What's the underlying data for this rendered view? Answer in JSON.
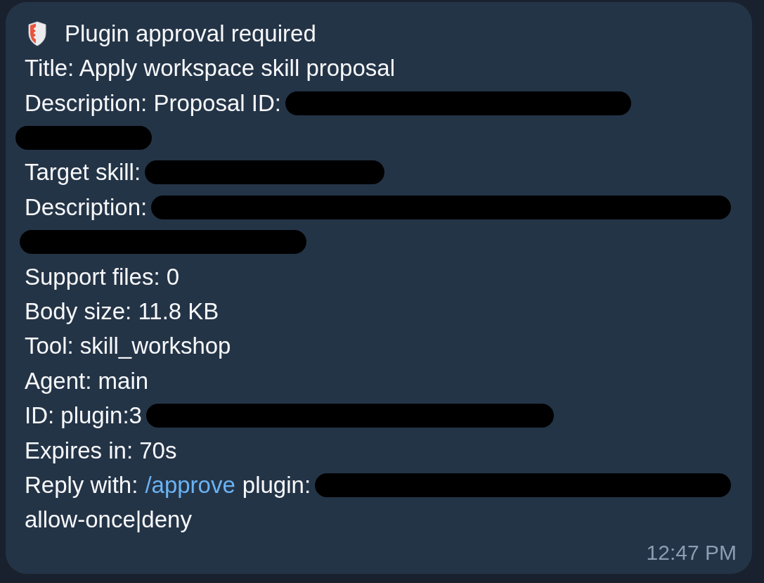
{
  "message": {
    "header": {
      "title": "Plugin approval required"
    },
    "lines": [
      {
        "kind": "text",
        "text": "Title: Apply workspace skill proposal",
        "redacted": false
      },
      {
        "kind": "text",
        "text": "Description: Proposal ID:",
        "redacted": true
      },
      {
        "kind": "redacted"
      },
      {
        "kind": "text",
        "text": "Target skill:",
        "redacted": true
      },
      {
        "kind": "text",
        "text": "Description:",
        "redacted": true
      },
      {
        "kind": "redacted"
      },
      {
        "kind": "text",
        "text": "Support files: 0",
        "redacted": false
      },
      {
        "kind": "text",
        "text": "Body size: 11.8 KB",
        "redacted": false
      },
      {
        "kind": "text",
        "text": "Tool: skill_workshop",
        "redacted": false
      },
      {
        "kind": "text",
        "text": "Agent: main",
        "redacted": false
      },
      {
        "kind": "text",
        "text": "ID: plugin:3",
        "redacted": true
      },
      {
        "kind": "text",
        "text": "Expires in: 70s",
        "redacted": false
      },
      {
        "kind": "reply",
        "label": "Reply with:",
        "command": "/approve",
        "text": "plugin:",
        "redacted": true
      },
      {
        "kind": "text",
        "text": "allow-once|deny",
        "redacted": false
      }
    ],
    "time": "12:47 PM"
  }
}
